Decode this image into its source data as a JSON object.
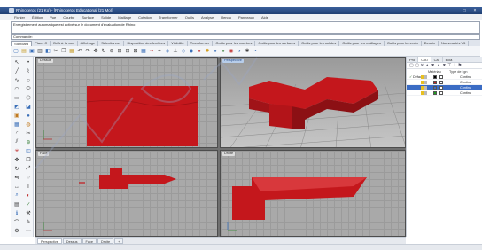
{
  "window": {
    "title": "Rhinoceros (21 Ko) - [Rhinoceros Educational (21 Mo)]",
    "controls": [
      "_",
      "□",
      "×"
    ],
    "title_color": "#274a85"
  },
  "menubar": {
    "items": [
      "Fichier",
      "Édition",
      "Vue",
      "Courbe",
      "Surface",
      "Solide",
      "Maillage",
      "Cotation",
      "Transformer",
      "Outils",
      "Analyse",
      "Rendu",
      "Panneaux",
      "Aide"
    ]
  },
  "command": {
    "history": "Enregistrement automatique est activé sur le document d'évaluation de Rhino",
    "prompt": "Commande:"
  },
  "toolbar_tabs": {
    "items": [
      "Standard",
      "Plans C",
      "Définir la vue",
      "Affichage",
      "Sélectionner",
      "Disposition des fenêtres",
      "Visibilité",
      "Transformer",
      "Outils pour les courbes",
      "Outils pour les surfaces",
      "Outils pour les solides",
      "Outils pour les maillages",
      "Outils pour le rendu",
      "Dessin",
      "Nouveautés V5"
    ],
    "active_index": 0
  },
  "toolbar": {
    "icons": [
      {
        "name": "new-icon",
        "glyph": "▢",
        "color": "#3a6fb8"
      },
      {
        "name": "open-icon",
        "glyph": "▤",
        "color": "#c8a030"
      },
      {
        "name": "save-icon",
        "glyph": "▣",
        "color": "#3a6fb8"
      },
      {
        "name": "print-icon",
        "glyph": "▥",
        "color": "#555555"
      },
      {
        "name": "import-icon",
        "glyph": "◧",
        "color": "#3a6fb8"
      },
      {
        "name": "cut-icon",
        "glyph": "✂",
        "color": "#444444"
      },
      {
        "name": "copy-icon",
        "glyph": "❐",
        "color": "#444444"
      },
      {
        "name": "paste-icon",
        "glyph": "▦",
        "color": "#c8a030"
      },
      {
        "name": "undo-icon",
        "glyph": "↶",
        "color": "#444444"
      },
      {
        "name": "redo-icon",
        "glyph": "↷",
        "color": "#444444"
      },
      {
        "name": "pan-icon",
        "glyph": "✥",
        "color": "#444444"
      },
      {
        "name": "rotate-view-icon",
        "glyph": "↻",
        "color": "#444444"
      },
      {
        "name": "zoom-icon",
        "glyph": "⊕",
        "color": "#444444"
      },
      {
        "name": "zoom-window-icon",
        "glyph": "⊞",
        "color": "#444444"
      },
      {
        "name": "zoom-extents-icon",
        "glyph": "⊡",
        "color": "#444444"
      },
      {
        "name": "zoom-selected-icon",
        "glyph": "⊠",
        "color": "#444444"
      },
      {
        "name": "four-viewports-icon",
        "glyph": "▦",
        "color": "#3a6fb8"
      },
      {
        "name": "arrow-icon",
        "glyph": "➜",
        "color": "#c03030"
      },
      {
        "name": "select-icon",
        "glyph": "⌖",
        "color": "#444444"
      },
      {
        "name": "grid-snap-icon",
        "glyph": "◈",
        "color": "#3a6fb8"
      },
      {
        "name": "ortho-icon",
        "glyph": "⊥",
        "color": "#444444"
      },
      {
        "name": "planar-icon",
        "glyph": "◇",
        "color": "#3a6fb8"
      },
      {
        "name": "layer-icon",
        "glyph": "◆",
        "color": "#3a6fb8"
      },
      {
        "name": "lock-icon",
        "glyph": "●",
        "color": "#c03030"
      },
      {
        "name": "light-icon",
        "glyph": "✹",
        "color": "#d4a020"
      },
      {
        "name": "render-icon",
        "glyph": "●",
        "color": "#3a6fb8"
      },
      {
        "name": "material-icon",
        "glyph": "●",
        "color": "#4a8a4a"
      },
      {
        "name": "texture-icon",
        "glyph": "◉",
        "color": "#c03030"
      },
      {
        "name": "environment-icon",
        "glyph": "◕",
        "color": "#3a6fb8"
      },
      {
        "name": "options-icon",
        "glyph": "✱",
        "color": "#444444"
      },
      {
        "name": "help-icon",
        "glyph": "◔",
        "color": "#3a6fb8"
      }
    ]
  },
  "left_tools": {
    "icons": [
      {
        "name": "select-arrow-icon",
        "glyph": "↖",
        "color": "#333333"
      },
      {
        "name": "point-icon",
        "glyph": "•",
        "color": "#333333"
      },
      {
        "name": "line-icon",
        "glyph": "╱",
        "color": "#333333"
      },
      {
        "name": "polyline-icon",
        "glyph": "⌇",
        "color": "#333333"
      },
      {
        "name": "curve-icon",
        "glyph": "∿",
        "color": "#333333"
      },
      {
        "name": "circle-icon",
        "glyph": "○",
        "color": "#333333"
      },
      {
        "name": "arc-icon",
        "glyph": "◠",
        "color": "#333333"
      },
      {
        "name": "ellipse-icon",
        "glyph": "⬭",
        "color": "#333333"
      },
      {
        "name": "rectangle-icon",
        "glyph": "▭",
        "color": "#333333"
      },
      {
        "name": "polygon-icon",
        "glyph": "⬡",
        "color": "#333333"
      },
      {
        "name": "surface-icon",
        "glyph": "◩",
        "color": "#3a6fb8"
      },
      {
        "name": "extrude-icon",
        "glyph": "◪",
        "color": "#3a6fb8"
      },
      {
        "name": "box-icon",
        "glyph": "▣",
        "color": "#c07a20"
      },
      {
        "name": "sphere-icon",
        "glyph": "●",
        "color": "#3a6fb8"
      },
      {
        "name": "mesh-icon",
        "glyph": "▦",
        "color": "#3a6fb8"
      },
      {
        "name": "boolean-union-icon",
        "glyph": "◍",
        "color": "#c07a20"
      },
      {
        "name": "fillet-icon",
        "glyph": "◜",
        "color": "#333333"
      },
      {
        "name": "trim-icon",
        "glyph": "✂",
        "color": "#333333"
      },
      {
        "name": "split-icon",
        "glyph": "⫽",
        "color": "#333333"
      },
      {
        "name": "join-icon",
        "glyph": "⊕",
        "color": "#4a8a4a"
      },
      {
        "name": "explode-icon",
        "glyph": "✳",
        "color": "#c03030"
      },
      {
        "name": "group-icon",
        "glyph": "◫",
        "color": "#3a6fb8"
      },
      {
        "name": "move-icon",
        "glyph": "✥",
        "color": "#333333"
      },
      {
        "name": "copy-tool-icon",
        "glyph": "❐",
        "color": "#333333"
      },
      {
        "name": "rotate-icon",
        "glyph": "↻",
        "color": "#333333"
      },
      {
        "name": "scale-icon",
        "glyph": "⤢",
        "color": "#333333"
      },
      {
        "name": "mirror-icon",
        "glyph": "⇋",
        "color": "#333333"
      },
      {
        "name": "array-icon",
        "glyph": "⁘",
        "color": "#333333"
      },
      {
        "name": "dimension-icon",
        "glyph": "↔",
        "color": "#333333"
      },
      {
        "name": "text-icon",
        "glyph": "T",
        "color": "#333333"
      },
      {
        "name": "analyze-icon",
        "glyph": "⌕",
        "color": "#3a6fb8"
      },
      {
        "name": "render-tool-icon",
        "glyph": "◐",
        "color": "#c03030"
      },
      {
        "name": "grid-icon",
        "glyph": "▤",
        "color": "#333333"
      },
      {
        "name": "check-icon",
        "glyph": "✓",
        "color": "#4a8a4a"
      },
      {
        "name": "info-icon",
        "glyph": "ℹ",
        "color": "#3a6fb8"
      },
      {
        "name": "tools-icon",
        "glyph": "⚒",
        "color": "#333333"
      },
      {
        "name": "curve-tools-icon",
        "glyph": "⌒",
        "color": "#333333"
      },
      {
        "name": "pencil-icon",
        "glyph": "✎",
        "color": "#333333"
      },
      {
        "name": "properties-icon",
        "glyph": "⚙",
        "color": "#333333"
      },
      {
        "name": "more-icon",
        "glyph": "⋯",
        "color": "#333333"
      }
    ]
  },
  "viewports": {
    "top": {
      "label": "Dessus",
      "active": false
    },
    "perspective": {
      "label": "Perspective",
      "active": true
    },
    "front": {
      "label": "Face",
      "active": false
    },
    "right": {
      "label": "Droite",
      "active": false
    },
    "model_color": "#c4171c"
  },
  "layers_panel": {
    "tabs": [
      "Pro",
      "Cou",
      "Cal",
      "Ecla"
    ],
    "active_tab": 1,
    "tool_glyphs": "▢ ▢ ✕ ▲ ▼ ▲ ▼ ⊤ ⊥ ⚑",
    "columns": {
      "material": "Matériau",
      "linetype": "Type de lign"
    },
    "rows": [
      {
        "name": "Défaut",
        "checked": true,
        "color": "#000000",
        "linetype": "Continu",
        "selected": false
      },
      {
        "name": "",
        "checked": false,
        "color": "#d02020",
        "linetype": "Continu",
        "selected": false
      },
      {
        "name": "",
        "checked": false,
        "color": "#3b6cc4",
        "linetype": "Continu",
        "selected": true
      },
      {
        "name": "",
        "checked": false,
        "color": "#20a020",
        "linetype": "Continu",
        "selected": false
      }
    ]
  },
  "viewport_tabs": {
    "items": [
      "Perspective",
      "Dessus",
      "Face",
      "Droite"
    ],
    "add_glyph": "+",
    "active_index": 0
  }
}
